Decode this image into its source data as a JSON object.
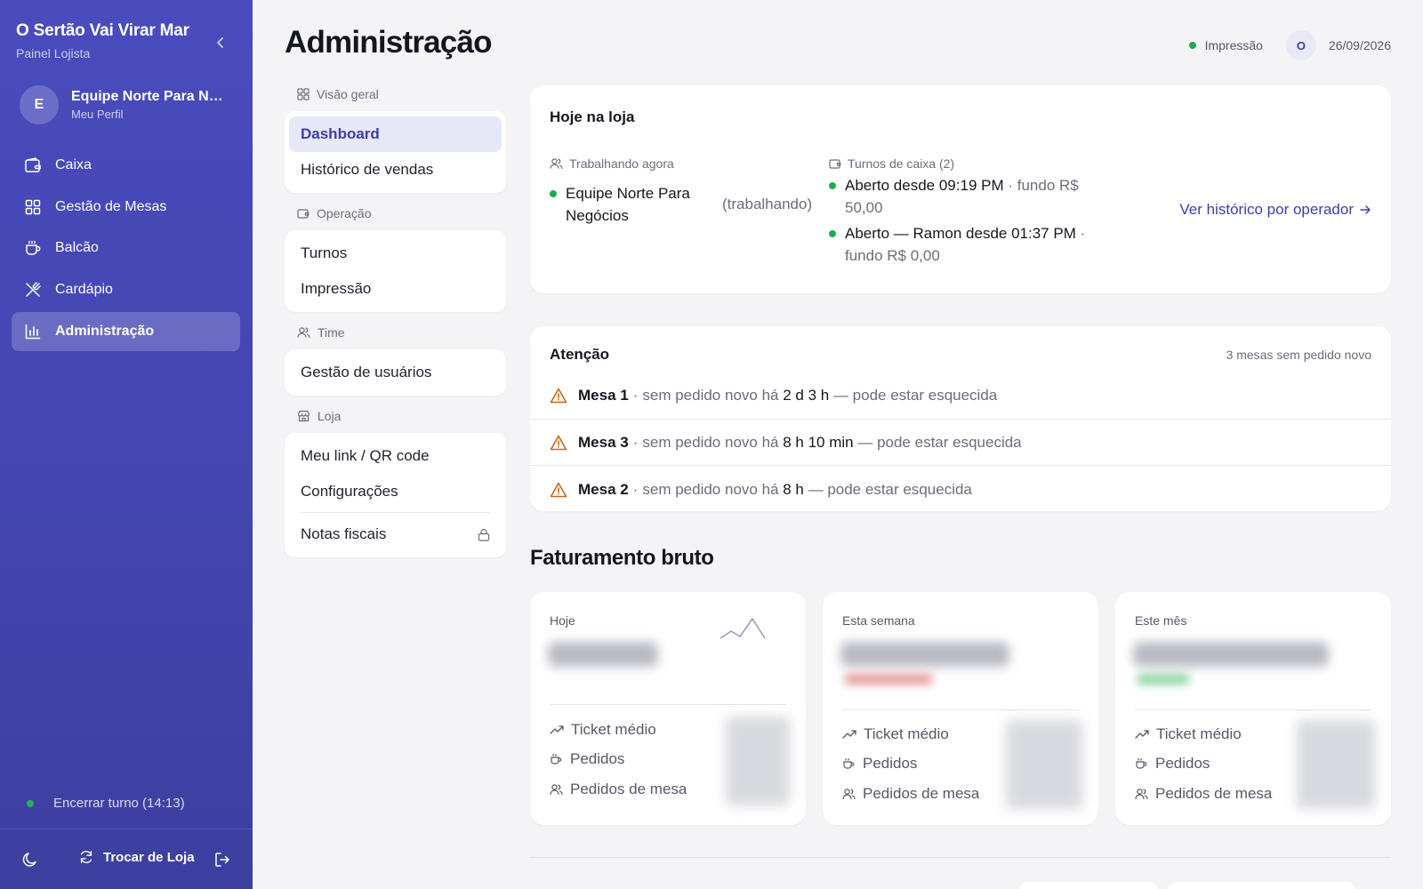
{
  "app": {
    "brand_title": "O Sertão Vai Virar Mar",
    "brand_subtitle": "Painel Lojista"
  },
  "profile": {
    "initial": "E",
    "name": "Equipe Norte Para Negócios",
    "subtitle": "Meu Perfil"
  },
  "sidebar": {
    "items": [
      {
        "label": "Caixa",
        "icon": "wallet-icon"
      },
      {
        "label": "Gestão de Mesas",
        "icon": "grid-icon"
      },
      {
        "label": "Balcão",
        "icon": "coffee-cup-icon"
      },
      {
        "label": "Cardápio",
        "icon": "utensils-icon"
      },
      {
        "label": "Administração",
        "icon": "bar-chart-icon",
        "active": true
      }
    ],
    "shift_label": "Encerrar turno (14:13)",
    "switch_store_label": "Trocar de Loja"
  },
  "header": {
    "title": "Administração",
    "print_status": "Impressão",
    "user_initial": "O",
    "date": "26/09/2026"
  },
  "subnav": {
    "sections": [
      {
        "label": "Visão geral",
        "icon": "layout-icon",
        "items": [
          "Dashboard",
          "Histórico de vendas"
        ],
        "active": "Dashboard"
      },
      {
        "label": "Operação",
        "icon": "wallet-icon",
        "items": [
          "Turnos",
          "Impressão"
        ]
      },
      {
        "label": "Time",
        "icon": "users-icon",
        "items": [
          "Gestão de usuários"
        ]
      },
      {
        "label": "Loja",
        "icon": "store-icon",
        "items": [
          "Meu link / QR code",
          "Configurações"
        ],
        "locked_item": "Notas fiscais"
      }
    ]
  },
  "today": {
    "title": "Hoje na loja",
    "working_label": "Trabalhando agora",
    "working_name": "Equipe Norte Para Negócios",
    "working_status": "(trabalhando)",
    "shifts_label": "Turnos de caixa (2)",
    "shifts": [
      {
        "status": "Aberto desde 09:19 PM",
        "fund": " · fundo R$ 50,00"
      },
      {
        "status": "Aberto — Ramon desde 01:37 PM",
        "fund": " · fundo R$ 0,00"
      }
    ],
    "history_link": "Ver histórico por operador"
  },
  "attention": {
    "title": "Atenção",
    "count_text": "3 mesas sem pedido novo",
    "prefix": "sem pedido novo há",
    "suffix": "— pode estar esquecida",
    "alerts": [
      {
        "table": "Mesa 1",
        "duration": "2 d 3 h"
      },
      {
        "table": "Mesa 3",
        "duration": "8 h 10 min"
      },
      {
        "table": "Mesa 2",
        "duration": "8 h"
      }
    ]
  },
  "revenue": {
    "title": "Faturamento bruto",
    "metric_labels": [
      "Ticket médio",
      "Pedidos",
      "Pedidos de mesa"
    ],
    "cards": [
      {
        "label": "Hoje"
      },
      {
        "label": "Esta semana"
      },
      {
        "label": "Este mês"
      }
    ]
  },
  "colors": {
    "sidebar": "#4546b3",
    "accent": "#3d3fa3",
    "status_green": "#1faa52",
    "warning": "#c7671b"
  }
}
